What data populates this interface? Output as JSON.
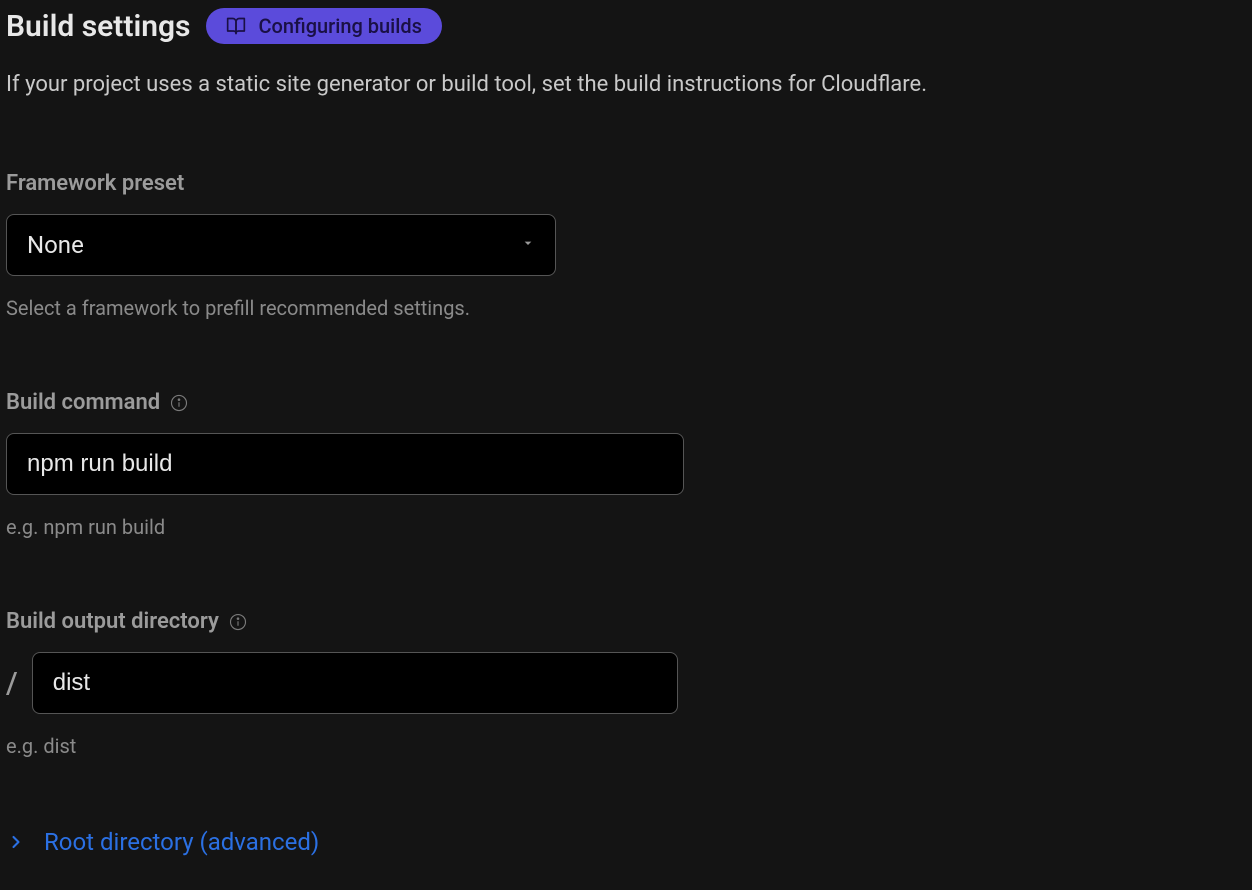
{
  "header": {
    "title": "Build settings",
    "badge_label": "Configuring builds"
  },
  "description": "If your project uses a static site generator or build tool, set the build instructions for Cloudflare.",
  "framework_preset": {
    "label": "Framework preset",
    "selected": "None",
    "helper": "Select a framework to prefill recommended settings."
  },
  "build_command": {
    "label": "Build command",
    "value": "npm run build",
    "helper": "e.g. npm run build"
  },
  "build_output": {
    "label": "Build output directory",
    "prefix": "/",
    "value": "dist",
    "helper": "e.g. dist"
  },
  "root_directory": {
    "label": "Root directory (advanced)"
  }
}
